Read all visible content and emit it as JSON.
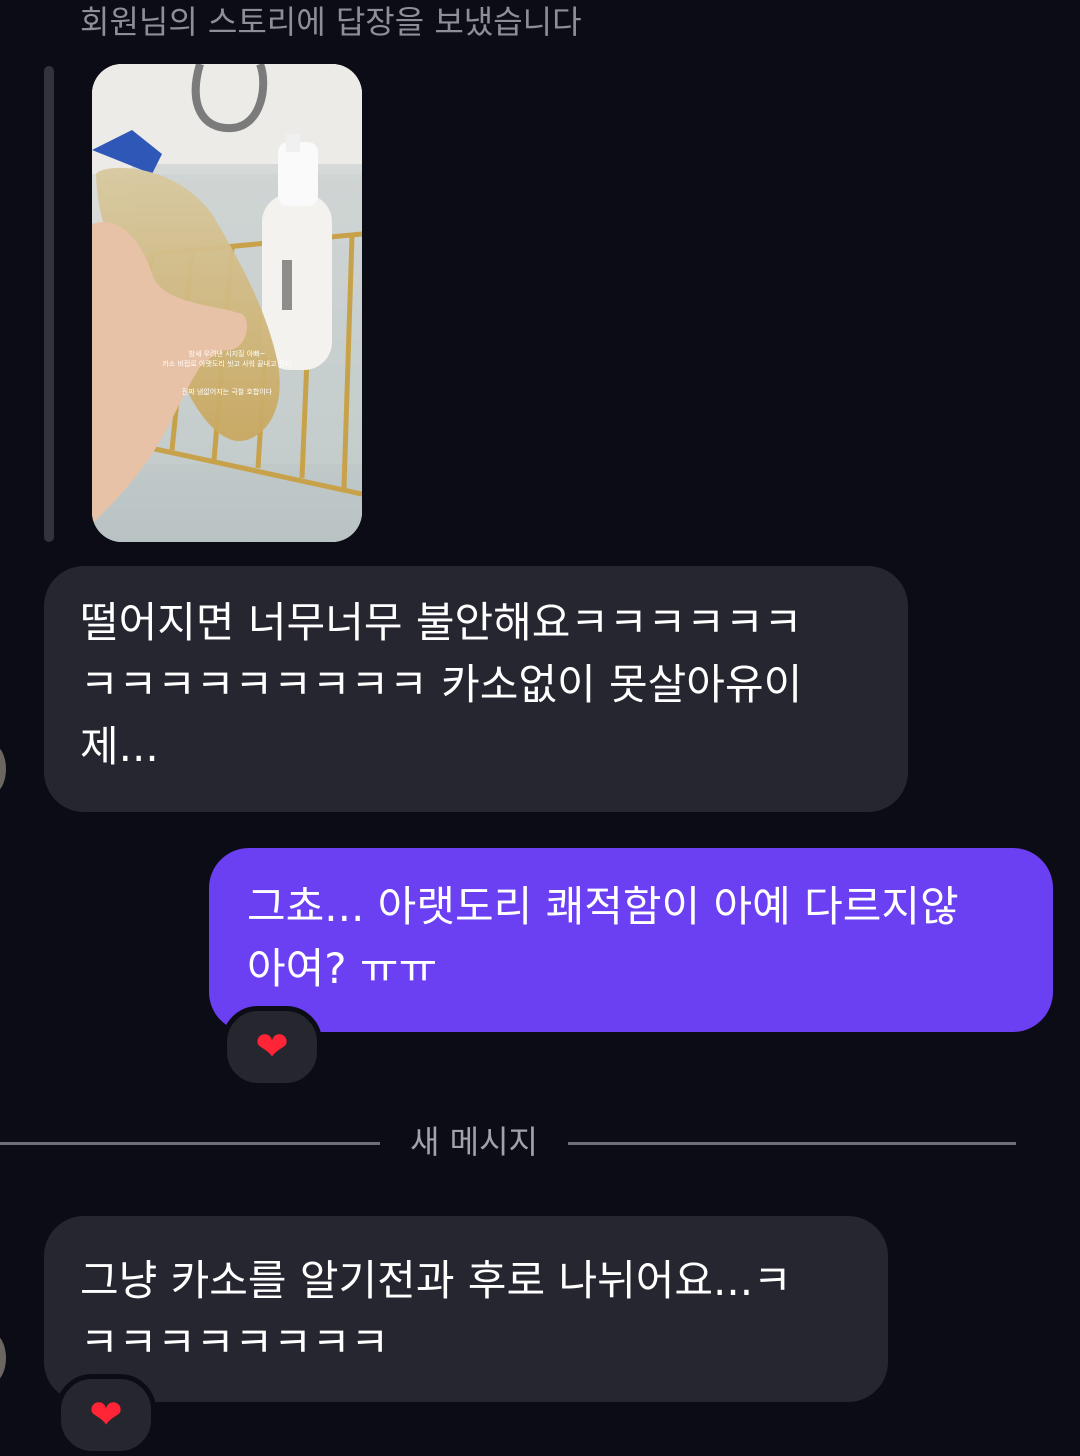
{
  "story_reply": {
    "header": "회원님의 스토리에 답장을 보냈습니다",
    "image_alt": "story photo: hand holding a plastic bottle in a bathtub next to a foam cleanser bottle",
    "overlay_lines": [
      "밤새 우려낸 시지질 아빠~",
      "카소 비접로 아랫도리 씻고 사워 끝내고 잔다",
      "진짜 냄없어지는 극찰 호합이다"
    ]
  },
  "messages": [
    {
      "direction": "incoming",
      "text": "떨어지면 너무너무 불안해요ㅋㅋㅋㅋㅋㅋ\nㅋㅋㅋㅋㅋㅋㅋㅋㅋ 카소없이 못살아유이\n제..."
    },
    {
      "direction": "outgoing",
      "text": "그쵸... 아랫도리 쾌적함이 아예 다르지않\n아여? ㅠㅠ",
      "reaction": "❤"
    },
    {
      "direction": "incoming",
      "text": "그냥 카소를 알기전과 후로 나뉘어요...ㅋ\nㅋㅋㅋㅋㅋㅋㅋㅋ",
      "reaction": "❤"
    }
  ],
  "divider": {
    "label": "새 메시지"
  },
  "colors": {
    "background": "#0c0c16",
    "incoming_bubble": "#262630",
    "outgoing_bubble": "#6b3ff2",
    "heart": "#ff2436"
  }
}
